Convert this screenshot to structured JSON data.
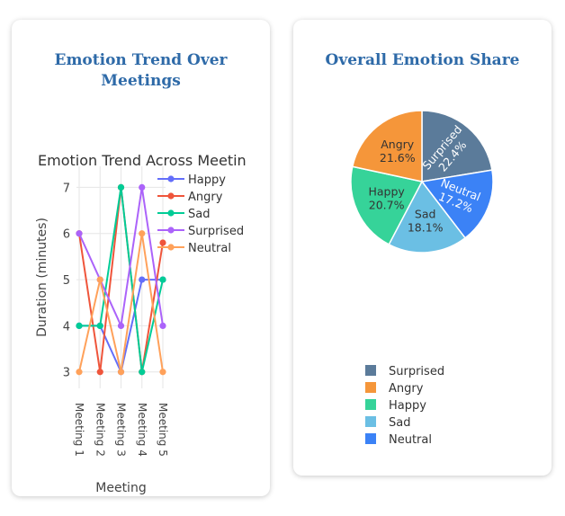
{
  "cards": {
    "left_title_line1": "Emotion Trend Over",
    "left_title_line2": "Meetings",
    "right_title": "Overall Emotion Share"
  },
  "colors": {
    "title": "#2e6aa8",
    "Happy": "#636efa",
    "Angry": "#ef553b",
    "Sad": "#00cc96",
    "Surprised": "#ab63fa",
    "Neutral": "#ffa15a",
    "pie_Surprised": "#5b7b9a",
    "pie_Angry": "#f5963a",
    "pie_Happy": "#36d399",
    "pie_Sad": "#6bbfe4",
    "pie_Neutral": "#3b82f6"
  },
  "chart_data": [
    {
      "type": "line",
      "title": "Emotion Trend Across Meetin",
      "xlabel": "Meeting",
      "ylabel": "Duration (minutes)",
      "categories": [
        "Meeting 1",
        "Meeting 2",
        "Meeting 3",
        "Meeting 4",
        "Meeting 5"
      ],
      "ylim": [
        2.8,
        7.3
      ],
      "yticks": [
        "3",
        "4",
        "5",
        "6",
        "7"
      ],
      "grid": true,
      "legend_position": "top-right",
      "series": [
        {
          "name": "Happy",
          "values": [
            4,
            4,
            3,
            5,
            5
          ]
        },
        {
          "name": "Angry",
          "values": [
            6,
            3,
            7,
            3,
            5.8
          ]
        },
        {
          "name": "Sad",
          "values": [
            4,
            4,
            7,
            3,
            5
          ]
        },
        {
          "name": "Surprised",
          "values": [
            6,
            5,
            4,
            7,
            4
          ]
        },
        {
          "name": "Neutral",
          "values": [
            3,
            5,
            3,
            6,
            3
          ]
        }
      ]
    },
    {
      "type": "pie",
      "title": "Overall Emotion Share",
      "legend_position": "bottom",
      "slices": [
        {
          "name": "Surprised",
          "value": 22.4,
          "label": "Surprised",
          "pct": "22.4%"
        },
        {
          "name": "Neutral",
          "value": 17.2,
          "label": "Neutral",
          "pct": "17.2%"
        },
        {
          "name": "Sad",
          "value": 18.1,
          "label": "Sad",
          "pct": "18.1%"
        },
        {
          "name": "Happy",
          "value": 20.7,
          "label": "Happy",
          "pct": "20.7%"
        },
        {
          "name": "Angry",
          "value": 21.6,
          "label": "Angry",
          "pct": "21.6%"
        }
      ],
      "legend": [
        "Surprised",
        "Angry",
        "Happy",
        "Sad",
        "Neutral"
      ]
    }
  ]
}
